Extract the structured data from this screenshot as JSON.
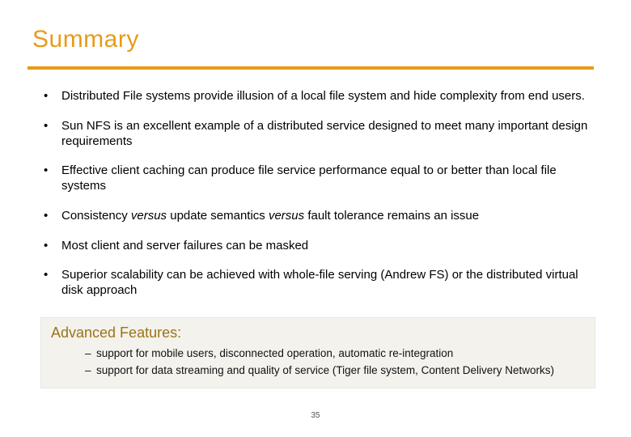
{
  "title": "Summary",
  "colors": {
    "accent": "#e79b1b",
    "box_bg": "#f4f2ed",
    "adv_title": "#9a7516"
  },
  "bullets": {
    "b1": "Distributed File systems provide illusion of a local file system and hide complexity from end users.",
    "b2": "Sun NFS is an excellent example of a distributed service designed to meet many important design requirements",
    "b3": "Effective client caching can produce file service performance equal to or better than local file systems",
    "b4a": "Consistency ",
    "b4b": "versus",
    "b4c": " update semantics ",
    "b4d": "versus",
    "b4e": " fault tolerance remains an issue",
    "b5": "Most client and server failures can be masked",
    "b6": "Superior scalability can be achieved with whole-file serving (Andrew FS) or the distributed virtual disk approach"
  },
  "advanced": {
    "heading": "Advanced Features:",
    "a1": "support for mobile users, disconnected operation, automatic re-integration",
    "a2": "support for data streaming and quality of service (Tiger file system, Content Delivery Networks)"
  },
  "page_number": "35"
}
